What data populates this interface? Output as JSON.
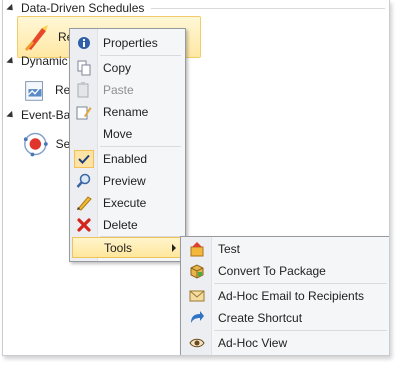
{
  "groups": [
    {
      "label": "Data-Driven Schedules",
      "item_label": "Rep"
    },
    {
      "label": "Dynamic",
      "item_label": "Rep"
    },
    {
      "label": "Event-Ba",
      "item_label": "Sep"
    }
  ],
  "context_menu": {
    "items": [
      {
        "label": "Properties",
        "icon": "properties-icon"
      },
      {
        "label": "Copy",
        "icon": "copy-icon"
      },
      {
        "label": "Paste",
        "icon": "paste-icon",
        "disabled": true
      },
      {
        "label": "Rename",
        "icon": "rename-icon"
      },
      {
        "label": "Move",
        "icon": ""
      },
      {
        "label": "Enabled",
        "icon": "check-icon",
        "checked": true
      },
      {
        "label": "Preview",
        "icon": "magnifier-icon"
      },
      {
        "label": "Execute",
        "icon": "execute-pencil-icon"
      },
      {
        "label": "Delete",
        "icon": "delete-x-icon"
      },
      {
        "label": "Tools",
        "icon": "",
        "submenu": true
      }
    ]
  },
  "tools_submenu": {
    "items": [
      {
        "label": "Test",
        "icon": "test-icon"
      },
      {
        "label": "Convert To Package",
        "icon": "package-icon"
      },
      {
        "label": "Ad-Hoc Email to Recipients",
        "icon": "email-icon"
      },
      {
        "label": "Create Shortcut",
        "icon": "shortcut-arrow-icon"
      },
      {
        "label": "Ad-Hoc View",
        "icon": "eye-icon"
      }
    ]
  },
  "colors": {
    "highlight_top": "#fff4cc",
    "highlight_bottom": "#ffe79b",
    "highlight_border": "#efc35b",
    "menu_bg": "#f5f6f7",
    "gutter_bg": "#eceef1"
  }
}
